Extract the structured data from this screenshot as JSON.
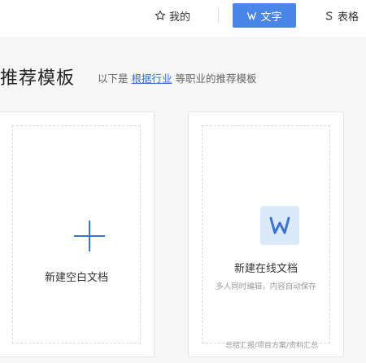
{
  "nav": {
    "mine_label": "我的",
    "text_label": "文字",
    "sheet_label": "表格"
  },
  "header": {
    "title": "推荐模板",
    "sub_prefix": "以下是",
    "sub_link": "根据行业",
    "sub_suffix": "等职业的推荐模板"
  },
  "cards": {
    "blank": {
      "label": "新建空白文档",
      "icon": "plus-icon"
    },
    "online": {
      "label": "新建在线文档",
      "sub": "多人同时编辑，内容自动保存",
      "tags": "总结汇报/项目方案/资料汇总",
      "icon": "w-doc-icon"
    }
  },
  "colors": {
    "accent": "#4a86e8",
    "link": "#3b72d6",
    "icon_bg": "#dce9fb"
  }
}
